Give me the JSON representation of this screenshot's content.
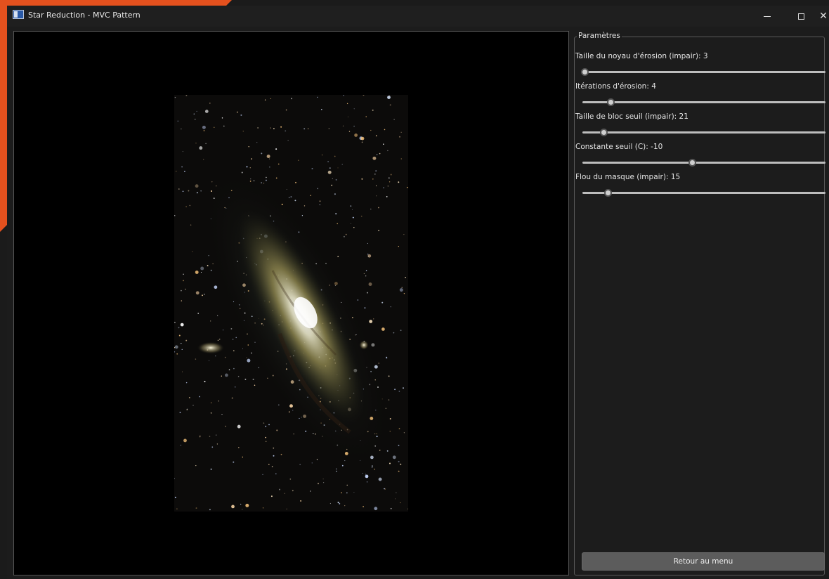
{
  "window": {
    "title": "Star Reduction - MVC Pattern",
    "controls": {
      "minimize": "–",
      "maximize": "□",
      "close": "✕"
    }
  },
  "image_viewer": {
    "content": "galaxy-image"
  },
  "params": {
    "legend": "Paramètres",
    "items": [
      {
        "label": "Taille du noyau d'érosion (impair): 3",
        "value": 0.01
      },
      {
        "label": "Itérations d'érosion: 4",
        "value": 0.116
      },
      {
        "label": "Taille de bloc seuil (impair): 21",
        "value": 0.087
      },
      {
        "label": "Constante seuil (C): -10",
        "value": 0.45
      },
      {
        "label": "Flou du masque (impair): 15",
        "value": 0.105
      }
    ]
  },
  "footer": {
    "menu_button": "Retour au menu"
  },
  "colors": {
    "accent": "#e4511e",
    "background": "#1c1c1c",
    "viewer": "#000000"
  }
}
